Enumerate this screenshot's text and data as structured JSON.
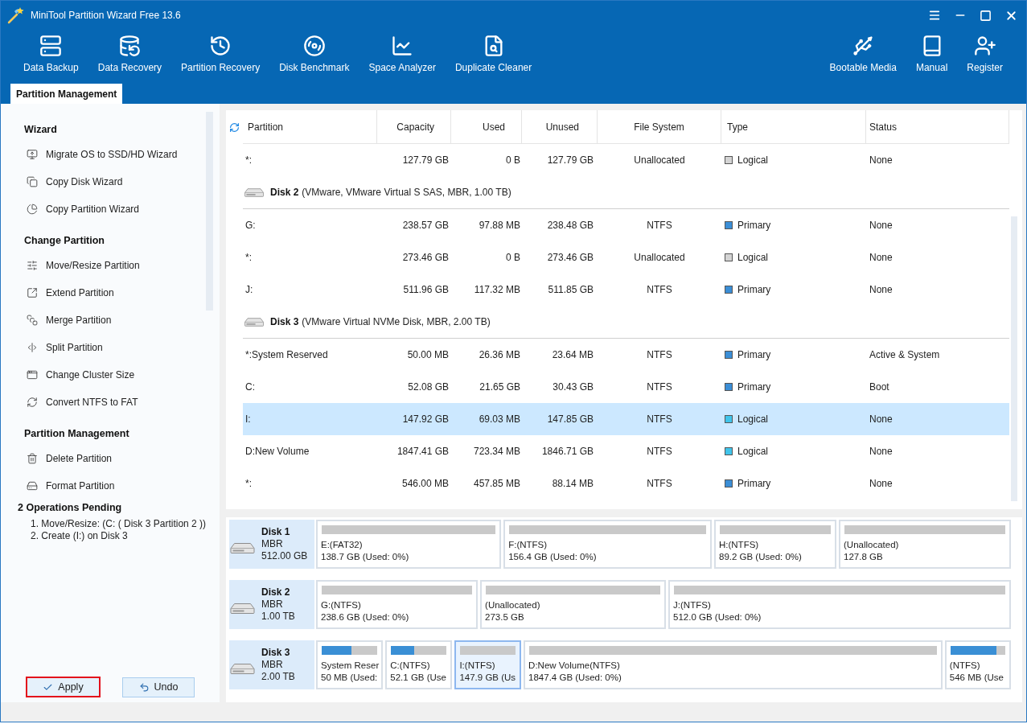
{
  "window": {
    "title": "MiniTool Partition Wizard Free 13.6"
  },
  "toolbar": {
    "left": [
      "Data Backup",
      "Data Recovery",
      "Partition Recovery",
      "Disk Benchmark",
      "Space Analyzer",
      "Duplicate Cleaner"
    ],
    "right": [
      "Bootable Media",
      "Manual",
      "Register"
    ]
  },
  "tabs": [
    {
      "label": "Partition Management",
      "selected": true
    }
  ],
  "sidebar": {
    "sections": [
      {
        "title": "Wizard",
        "items": [
          "Migrate OS to SSD/HD Wizard",
          "Copy Disk Wizard",
          "Copy Partition Wizard"
        ]
      },
      {
        "title": "Change Partition",
        "items": [
          "Move/Resize Partition",
          "Extend Partition",
          "Merge Partition",
          "Split Partition",
          "Change Cluster Size",
          "Convert NTFS to FAT"
        ]
      },
      {
        "title": "Partition Management",
        "items": [
          "Delete Partition",
          "Format Partition"
        ]
      }
    ],
    "pending": {
      "title": "2 Operations Pending",
      "items": [
        "1. Move/Resize: (C: ( Disk 3 Partition 2 ))",
        "2. Create (I:) on Disk 3"
      ]
    },
    "buttons": [
      {
        "label": "Apply",
        "highlighted": true
      },
      {
        "label": "Undo",
        "highlighted": false
      }
    ]
  },
  "table": {
    "columns": [
      "Partition",
      "Capacity",
      "Used",
      "Unused",
      "File System",
      "Type",
      "Status"
    ],
    "rows": [
      {
        "kind": "partition",
        "selected": false,
        "partition": "*:",
        "capacity": "127.79 GB",
        "used": "0 B",
        "unused": "127.79 GB",
        "file_system": "Unallocated",
        "type": "Logical",
        "color": "#d4d4d4",
        "status": "None"
      },
      {
        "kind": "disk",
        "selected": false,
        "name": "Disk 2",
        "details": "(VMware, VMware Virtual S SAS, MBR, 1.00 TB)"
      },
      {
        "kind": "partition",
        "selected": false,
        "partition": "G:",
        "capacity": "238.57 GB",
        "used": "97.88 MB",
        "unused": "238.48 GB",
        "file_system": "NTFS",
        "type": "Primary",
        "color": "#3b8ed6",
        "status": "None"
      },
      {
        "kind": "partition",
        "selected": false,
        "partition": "*:",
        "capacity": "273.46 GB",
        "used": "0 B",
        "unused": "273.46 GB",
        "file_system": "Unallocated",
        "type": "Logical",
        "color": "#d4d4d4",
        "status": "None"
      },
      {
        "kind": "partition",
        "selected": false,
        "partition": "J:",
        "capacity": "511.96 GB",
        "used": "117.32 MB",
        "unused": "511.85 GB",
        "file_system": "NTFS",
        "type": "Primary",
        "color": "#3b8ed6",
        "status": "None"
      },
      {
        "kind": "disk",
        "selected": false,
        "name": "Disk 3",
        "details": "(VMware Virtual NVMe Disk, MBR, 2.00 TB)"
      },
      {
        "kind": "partition",
        "selected": false,
        "partition": "*:System Reserved",
        "capacity": "50.00 MB",
        "used": "26.36 MB",
        "unused": "23.64 MB",
        "file_system": "NTFS",
        "type": "Primary",
        "color": "#3b8ed6",
        "status": "Active & System"
      },
      {
        "kind": "partition",
        "selected": false,
        "partition": "C:",
        "capacity": "52.08 GB",
        "used": "21.65 GB",
        "unused": "30.43 GB",
        "file_system": "NTFS",
        "type": "Primary",
        "color": "#3b8ed6",
        "status": "Boot"
      },
      {
        "kind": "partition",
        "selected": true,
        "partition": "I:",
        "capacity": "147.92 GB",
        "used": "69.03 MB",
        "unused": "147.85 GB",
        "file_system": "NTFS",
        "type": "Logical",
        "color": "#40c4ea",
        "status": "None"
      },
      {
        "kind": "partition",
        "selected": false,
        "partition": "D:New Volume",
        "capacity": "1847.41 GB",
        "used": "723.34 MB",
        "unused": "1846.71 GB",
        "file_system": "NTFS",
        "type": "Logical",
        "color": "#40c4ea",
        "status": "None"
      },
      {
        "kind": "partition",
        "selected": false,
        "partition": "*:",
        "capacity": "546.00 MB",
        "used": "457.85 MB",
        "unused": "88.14 MB",
        "file_system": "NTFS",
        "type": "Primary",
        "color": "#3b8ed6",
        "status": "None"
      }
    ]
  },
  "disk_map": [
    {
      "name": "Disk 1",
      "scheme": "MBR",
      "size": "512.00 GB",
      "partitions": [
        {
          "label": "E:(FAT32)",
          "detail": "138.7 GB (Used: 0%)",
          "selected": false
        },
        {
          "label": "F:(NTFS)",
          "detail": "156.4 GB (Used: 0%)",
          "selected": false
        },
        {
          "label": "H:(NTFS)",
          "detail": "89.2 GB (Used: 0%)",
          "selected": false
        },
        {
          "label": "(Unallocated)",
          "detail": "127.8 GB",
          "selected": false
        }
      ]
    },
    {
      "name": "Disk 2",
      "scheme": "MBR",
      "size": "1.00 TB",
      "partitions": [
        {
          "label": "G:(NTFS)",
          "detail": "238.6 GB (Used: 0%)",
          "selected": false
        },
        {
          "label": "(Unallocated)",
          "detail": "273.5 GB",
          "selected": false
        },
        {
          "label": "J:(NTFS)",
          "detail": "512.0 GB (Used: 0%)",
          "selected": false
        }
      ]
    },
    {
      "name": "Disk 3",
      "scheme": "MBR",
      "size": "2.00 TB",
      "partitions": [
        {
          "label": "System Reser",
          "detail": "50 MB (Used:",
          "level": 0.53,
          "selected": false
        },
        {
          "label": "C:(NTFS)",
          "detail": "52.1 GB (Use",
          "level": 0.42,
          "selected": false
        },
        {
          "label": "I:(NTFS)",
          "detail": "147.9 GB (Us",
          "selected": true
        },
        {
          "label": "D:New Volume(NTFS)",
          "detail": "1847.4 GB (Used: 0%)",
          "selected": false
        },
        {
          "label": "(NTFS)",
          "detail": "546 MB (Use",
          "level": 0.84,
          "selected": false
        }
      ]
    }
  ]
}
